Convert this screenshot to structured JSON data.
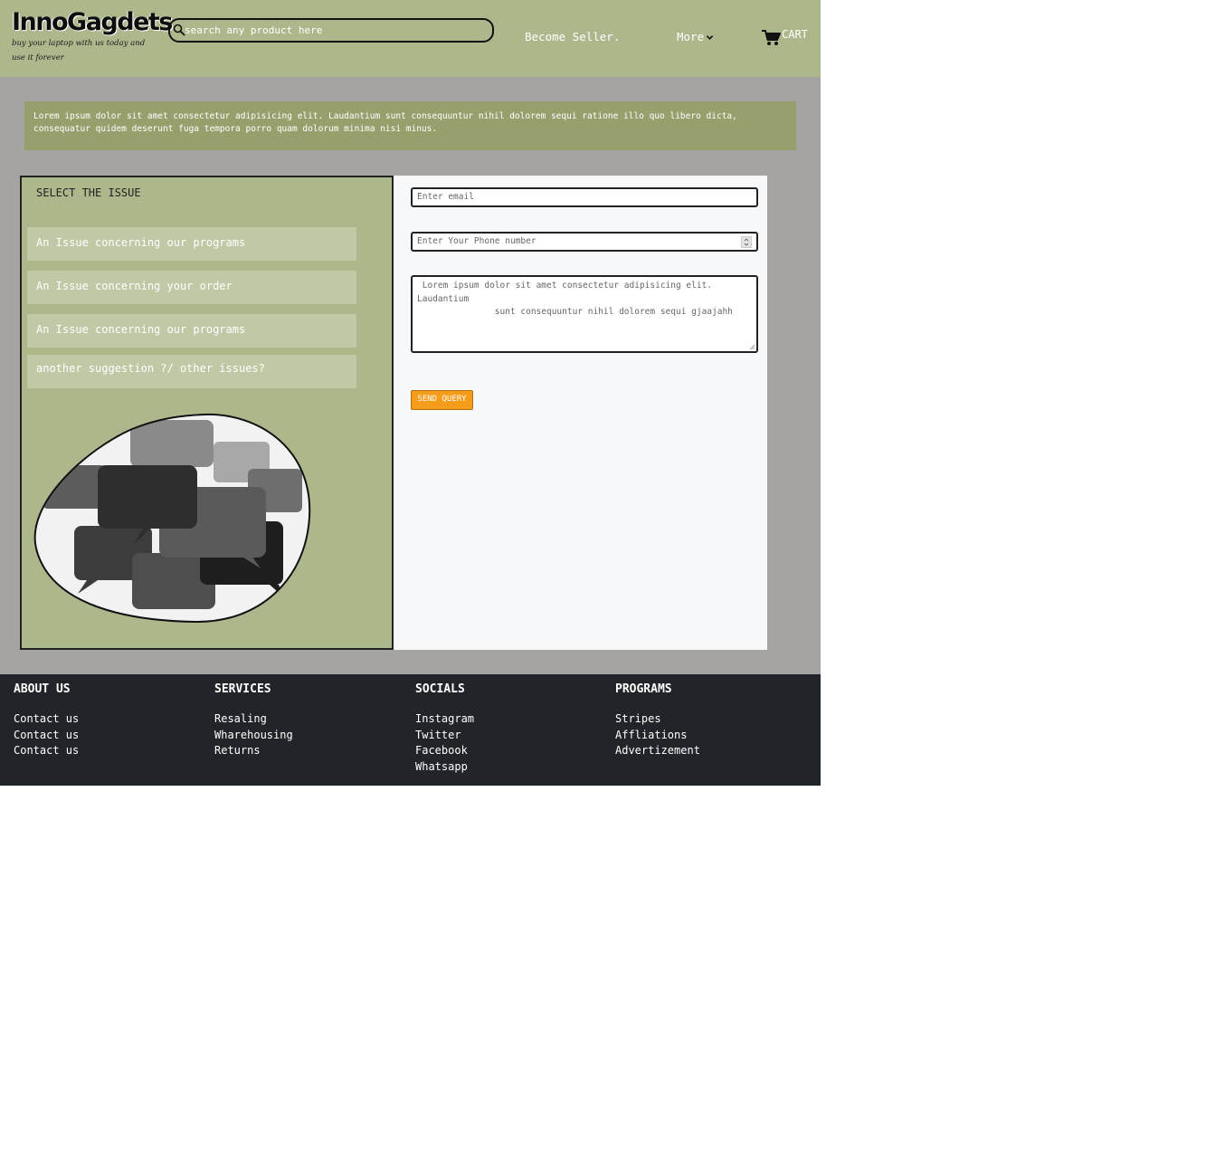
{
  "header": {
    "logo": "InnoGagdets",
    "tagline": "buy your laptop with us today and use it forever",
    "search_placeholder": "search any product here",
    "nav": {
      "seller": "Become Seller.",
      "more": "More",
      "cart": "CART"
    }
  },
  "notice": "Lorem ipsum dolor sit amet consectetur adipisicing elit. Laudantium sunt consequuntur nihil dolorem sequi ratione illo quo libero dicta, consequatur quidem deserunt fuga tempora porro quam dolorum minima nisi minus.",
  "issues": {
    "title": "SELECT THE ISSUE",
    "items": [
      "An Issue concerning our programs",
      "An Issue concerning your order",
      "An Issue concerning our programs",
      "another suggestion ?/ other issues?"
    ]
  },
  "form": {
    "email_placeholder": "Enter email",
    "phone_placeholder": "Enter Your Phone number",
    "message_value": " Lorem ipsum dolor sit amet consectetur adipisicing elit.\nLaudantium\n               sunt consequuntur nihil dolorem sequi gjaajahh",
    "send_label": "SEND QUERY"
  },
  "footer": {
    "columns": [
      {
        "heading": "ABOUT US",
        "links": [
          "Contact us",
          "Contact us",
          "Contact us"
        ]
      },
      {
        "heading": "SERVICES",
        "links": [
          "Resaling",
          "Wharehousing",
          "Returns"
        ]
      },
      {
        "heading": "SOCIALS",
        "links": [
          "Instagram",
          "Twitter",
          "Facebook",
          "Whatsapp"
        ]
      },
      {
        "heading": "PROGRAMS",
        "links": [
          "Stripes",
          "Affliations",
          "Advertizement"
        ]
      }
    ]
  },
  "colors": {
    "header_bg": "#adb78c",
    "main_bg": "#a5a4a2",
    "notice_bg": "#97a06d",
    "panel_bg": "#adb78c",
    "issue_btn_bg": "#c0c9a5",
    "send_btn": "#f59c1a",
    "footer_bg": "#212428"
  }
}
